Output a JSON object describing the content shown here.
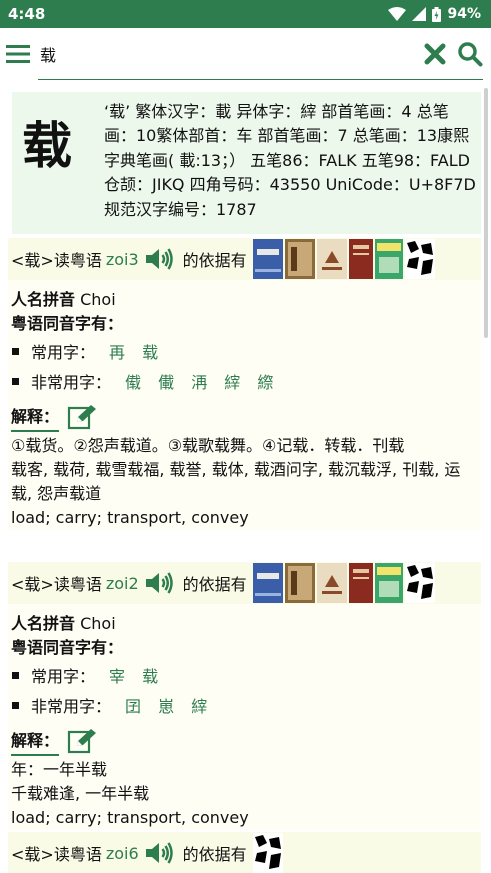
{
  "status": {
    "time": "4:48",
    "battery": "94%"
  },
  "search": {
    "query": "载"
  },
  "entry": {
    "char": "载",
    "info": "‘载’  繁体汉字：載  异体字：縡  部首笔画：4  总笔画：10繁体部首：车  部首笔画：7  总笔画：13康熙字典笔画( 載:13；）  五笔86：FALK  五笔98：FALD  仓颉：JIKQ  四角号码：43550  UniCode：U+8F7D  规范汉字编号：1787"
  },
  "sections": [
    {
      "prefix": "<载>读粤语",
      "roman": "zoi3",
      "basis": "的依据有",
      "name_pinyin_label": "人名拼音",
      "name_pinyin": "Choi",
      "homophone_label": "粤语同音字有：",
      "common_label": "常用字：",
      "common": "再 载",
      "uncommon_label": "非常用字：",
      "uncommon": "傤 儎 洅 縡 縩",
      "explain_label": "解释：",
      "explain": [
        "①载货。②怨声载道。③载歌载舞。④记载．转载．刊载",
        "载客, 载荷, 载雪载福, 载誉, 载体, 载酒问字, 载沉载浮, 刊载, 运",
        "载, 怨声载道",
        "load; carry; transport, convey"
      ]
    },
    {
      "prefix": "<载>读粤语",
      "roman": "zoi2",
      "basis": "的依据有",
      "name_pinyin_label": "人名拼音",
      "name_pinyin": "Choi",
      "homophone_label": "粤语同音字有：",
      "common_label": "常用字：",
      "common": "宰 载",
      "uncommon_label": "非常用字：",
      "uncommon": "囝 崽 縡",
      "explain_label": "解释：",
      "explain": [
        "年：一年半载",
        "千载难逢, 一年半载",
        "load; carry; transport, convey"
      ]
    },
    {
      "prefix": "<载>读粤语",
      "roman": "zoi6",
      "basis": "的依据有"
    }
  ],
  "colors": {
    "accent": "#2e7d4f",
    "info_bg": "#edf8ed",
    "head_bg": "#f9fbe7"
  }
}
